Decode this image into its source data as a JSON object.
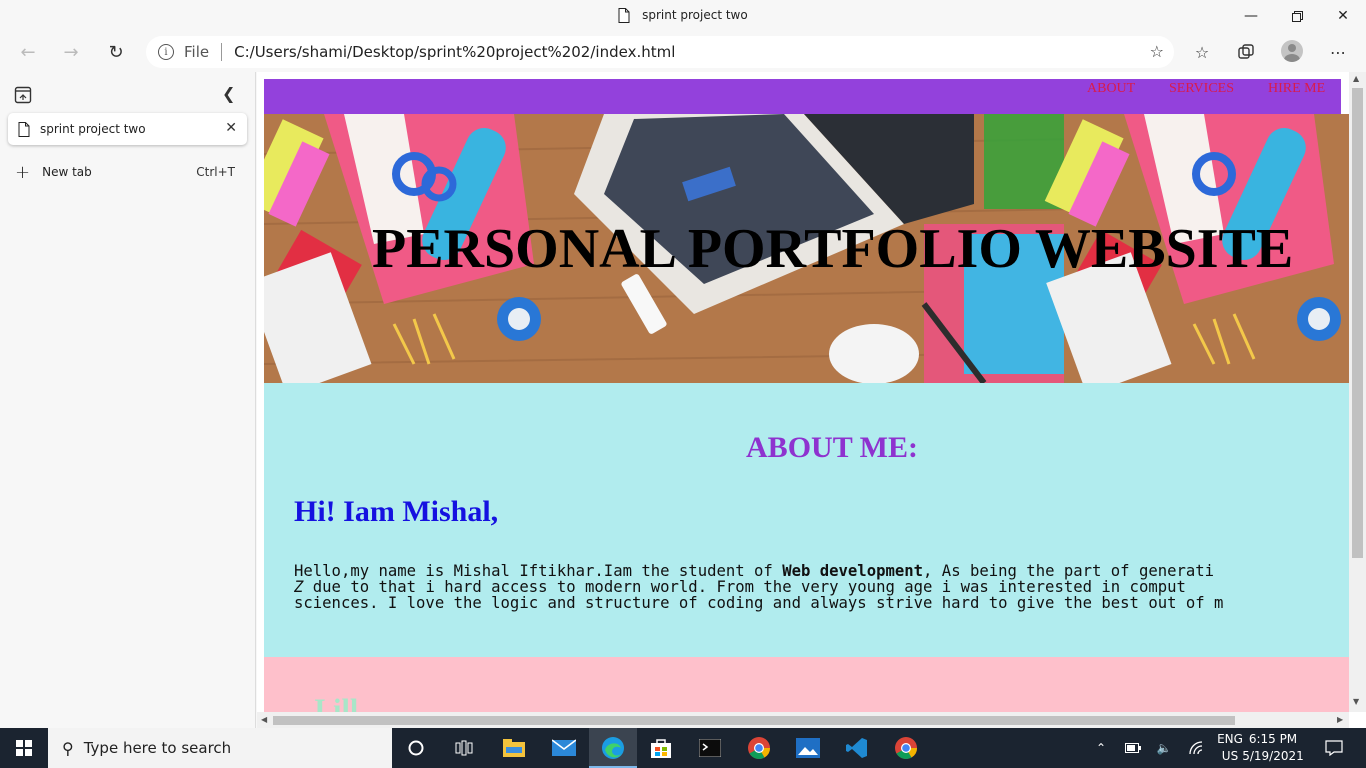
{
  "window": {
    "title": "sprint project two",
    "minimize_icon": "minimize-icon",
    "maximize_icon": "restore-icon",
    "close_icon": "close-icon"
  },
  "toolbar": {
    "back_icon": "back-arrow-icon",
    "forward_icon": "forward-arrow-icon",
    "refresh_icon": "refresh-icon",
    "address": {
      "scheme_label": "File",
      "url": "C:/Users/shami/Desktop/sprint%20project%202/index.html"
    }
  },
  "sidebar": {
    "tabs": [
      {
        "label": "sprint project two"
      }
    ],
    "new_tab_label": "New tab",
    "new_tab_shortcut": "Ctrl+T"
  },
  "page": {
    "nav": [
      "ABOUT",
      "SERVICES",
      "HIRE ME"
    ],
    "hero_title": "PERSONAL PORTFOLIO WEBSITE",
    "about_heading": "ABOUT ME:",
    "greeting": "Hi! Iam Mishal,",
    "para_line1_a": "Hello,my name is Mishal Iftikhar.Iam the student of ",
    "para_line1_bold": "Web development",
    "para_line1_b": ", As being the part of generati",
    "para_line2_a": "Z",
    "para_line2_b": " due to that i hard access to modern world. From the very young age i was interested in comput",
    "para_line3": "sciences. I love the logic and structure of coding and always strive hard to give the best out of m",
    "next_section_peek": "I ill"
  },
  "taskbar": {
    "search_placeholder": "Type here to search",
    "lang_top": "ENG",
    "lang_bottom": "US",
    "time": "6:15 PM",
    "date": "5/19/2021"
  },
  "colors": {
    "nav_bg": "#9341dc",
    "nav_link": "#d91b4b",
    "about_bg": "#b1ecee",
    "about_heading": "#8e32cf",
    "greeting": "#1511e0",
    "next_section_bg": "#fec0cb"
  }
}
